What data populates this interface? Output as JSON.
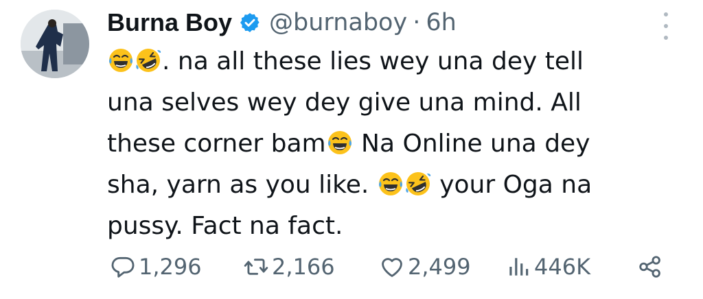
{
  "author": {
    "name": "Burna Boy",
    "handle": "@burnaboy",
    "separator": "·",
    "time": "6h"
  },
  "tweet": {
    "lines": [
      [
        {
          "emoji": "joy"
        },
        {
          "emoji": "rofl"
        },
        {
          "text": ". na all these lies wey una dey tell"
        }
      ],
      [
        {
          "text": "una selves wey dey give una mind. All"
        }
      ],
      [
        {
          "text": "these corner bam"
        },
        {
          "emoji": "joy"
        },
        {
          "text": " Na Online una dey"
        }
      ],
      [
        {
          "text": "sha, yarn as you like. "
        },
        {
          "emoji": "joy"
        },
        {
          "emoji": "rofl"
        },
        {
          "text": " your Oga na"
        }
      ],
      [
        {
          "text": "pussy. Fact na fact."
        }
      ]
    ]
  },
  "actions": {
    "replies": "1,296",
    "retweets": "2,166",
    "likes": "2,499",
    "views": "446K"
  },
  "icons": {
    "reply": "reply-icon",
    "retweet": "retweet-icon",
    "like": "heart-icon",
    "views": "views-icon",
    "share": "share-icon",
    "more": "more-icon",
    "verified": "verified-icon"
  },
  "colors": {
    "text": "#0f1419",
    "muted": "#536471",
    "verified": "#1d9bf0",
    "emoji_face": "#fcc21b"
  }
}
